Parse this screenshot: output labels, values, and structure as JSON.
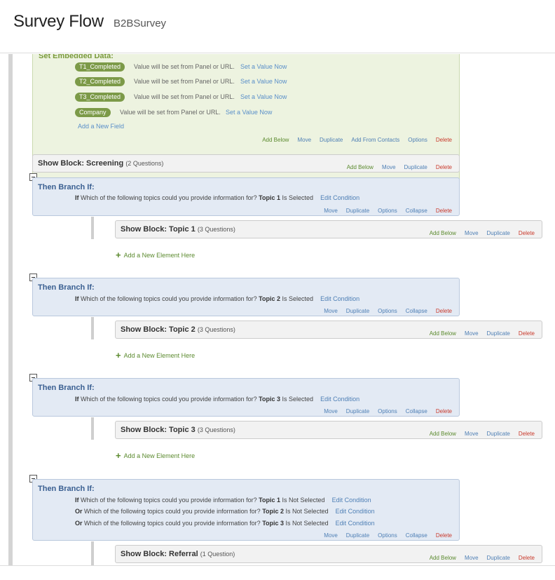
{
  "header": {
    "title": "Survey Flow",
    "survey_name": "B2BSurvey"
  },
  "embedded": {
    "title": "Set Embedded Data:",
    "fields": [
      {
        "name": "T1_Completed",
        "value": "Value will be set from Panel or URL.",
        "link": "Set a Value Now"
      },
      {
        "name": "T2_Completed",
        "value": "Value will be set from Panel or URL.",
        "link": "Set a Value Now"
      },
      {
        "name": "T3_Completed",
        "value": "Value will be set from Panel or URL.",
        "link": "Set a Value Now"
      },
      {
        "name": "Company",
        "value": "Value will be set from Panel or URL.",
        "link": "Set a Value Now"
      }
    ],
    "add_field": "Add a New Field",
    "actions": {
      "add_below": "Add Below",
      "move": "Move",
      "duplicate": "Duplicate",
      "add_from_contacts": "Add From Contacts",
      "options": "Options",
      "delete": "Delete"
    }
  },
  "screening": {
    "title": "Show Block: Screening",
    "count": "(2 Questions)",
    "actions": {
      "add_below": "Add Below",
      "move": "Move",
      "duplicate": "Duplicate",
      "delete": "Delete"
    }
  },
  "branch_title": "Then Branch If:",
  "branch_actions": {
    "move": "Move",
    "duplicate": "Duplicate",
    "options": "Options",
    "collapse": "Collapse",
    "delete": "Delete"
  },
  "block_actions": {
    "add_below": "Add Below",
    "move": "Move",
    "duplicate": "Duplicate",
    "delete": "Delete"
  },
  "add_new_element": "Add a New Element Here",
  "question_text": "Which of the following topics could you provide information for?",
  "edit_condition": "Edit Condition",
  "branches": [
    {
      "conditions": [
        {
          "op": "If",
          "topic": "Topic 1",
          "state": "Is Selected"
        }
      ],
      "block": {
        "title": "Show Block: Topic 1",
        "count": "(3 Questions)"
      }
    },
    {
      "conditions": [
        {
          "op": "If",
          "topic": "Topic 2",
          "state": "Is Selected"
        }
      ],
      "block": {
        "title": "Show Block: Topic 2",
        "count": "(3 Questions)"
      }
    },
    {
      "conditions": [
        {
          "op": "If",
          "topic": "Topic 3",
          "state": "Is Selected"
        }
      ],
      "block": {
        "title": "Show Block: Topic 3",
        "count": "(3 Questions)"
      }
    },
    {
      "conditions": [
        {
          "op": "If",
          "topic": "Topic 1",
          "state": "Is Not Selected"
        },
        {
          "op": "Or",
          "topic": "Topic 2",
          "state": "Is Not Selected"
        },
        {
          "op": "Or",
          "topic": "Topic 3",
          "state": "Is Not Selected"
        }
      ],
      "block": {
        "title": "Show Block: Referral",
        "count": "(1 Question)"
      }
    }
  ],
  "colors": {
    "embedded_bg": "#edf3e0",
    "branch_bg": "#e3eaf4",
    "block_bg": "#f2f2f2",
    "pill": "#7c9a48",
    "link": "#4e7fb5",
    "delete": "#c9392b"
  }
}
